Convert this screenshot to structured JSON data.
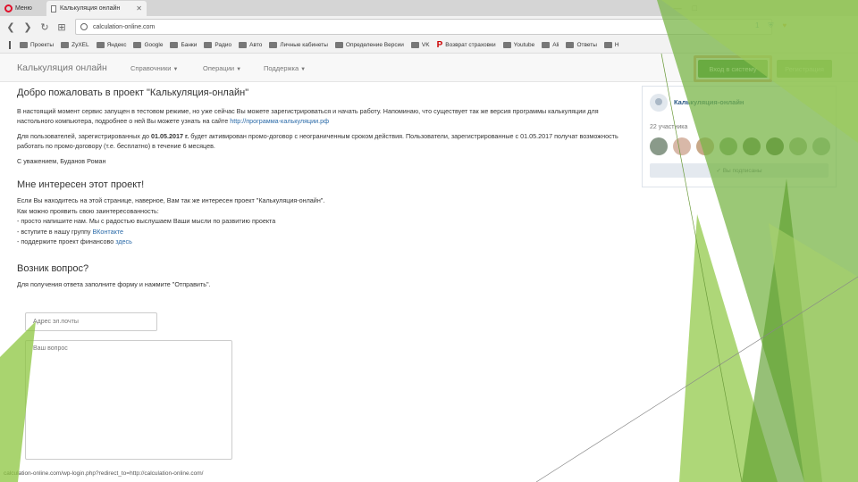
{
  "browser": {
    "menu_label": "Меню",
    "active_tab_title": "Калькуляция онлайн",
    "url": "calculation-online.com",
    "right_number": "1",
    "bookmarks": [
      "Проекты",
      "ZyXEL",
      "Яндекс",
      "Google",
      "Банки",
      "Радио",
      "Авто",
      "Личные кабинеты",
      "Определение Версии",
      "VK",
      "Возврат страховки",
      "Youtube",
      "Ali",
      "Ответы",
      "Н"
    ],
    "status_url": "calculation-online.com/wp-login.php?redirect_to=http://calculation-online.com/"
  },
  "site_nav": {
    "brand": "Калькуляция онлайн",
    "links": [
      "Справочники",
      "Операции",
      "Поддержка"
    ],
    "login_label": "Вход в систему",
    "register_label": "Регистрация"
  },
  "main": {
    "welcome_title": "Добро пожаловать в проект \"Калькуляция-онлайн\"",
    "p1_text": "В настоящий момент сервис запущен в тестовом режиме, но уже сейчас Вы можете зарегистрироваться и начать работу. Напоминаю, что существует так же версия программы калькуляции для настольного компьютера, подробнее о ней Вы можете узнать на сайте ",
    "p1_link": "http://программа-калькуляции.рф",
    "p2_before": "Для пользователей, зарегистрированных до ",
    "p2_date": "01.05.2017 г.",
    "p2_after": " будет активирован промо-договор с неограниченным сроком действия. Пользователи, зарегистрированные с 01.05.2017 получат возможность работать по промо-договору (т.е. бесплатно) в течение 6 месяцев.",
    "signature": "С уважением, Буданов Роман",
    "interest_title": "Мне интересен этот проект!",
    "interest_lines": [
      "Если Вы находитесь на этой странице, наверное, Вам так же интересен проект \"Калькуляция-онлайн\".",
      "Как можно проявить свою заинтересованность:",
      "- просто напишите нам. Мы с радостью выслушаем Ваши мысли по развитию проекта"
    ],
    "vk_line_prefix": "- вступите в нашу группу ",
    "vk_link": "ВКонтакте",
    "finance_prefix": "- поддержите проект финансово ",
    "finance_link": "здесь",
    "question_title": "Возник вопрос?",
    "question_hint": "Для получения ответа заполните форму и нажмите \"Отправить\".",
    "email_placeholder": "Адрес эл.почты",
    "question_placeholder": "Ваш вопрос"
  },
  "vk_widget": {
    "group_name": "Калькуляция-онлайн",
    "members": "22 участника",
    "subscribed_label": "Вы подписаны",
    "avatar_colors": [
      "#8a9a8a",
      "#d8b8a8",
      "#c8a888",
      "#7a9a6a",
      "#5a7a4a",
      "#4a6a3a",
      "#9ab08a",
      "#a0b8a0"
    ]
  },
  "colors": {
    "accent_green": "#3a8a2c",
    "highlight_border": "#e4a47c",
    "link_blue": "#2a6aa8",
    "slide_green": "#7ab648"
  }
}
